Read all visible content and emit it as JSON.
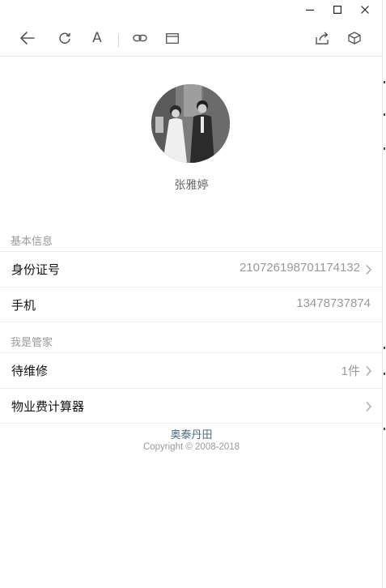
{
  "window": {
    "controls": [
      {
        "name": "minimize",
        "icon": "minimize-icon"
      },
      {
        "name": "maximize",
        "icon": "maximize-icon"
      },
      {
        "name": "close",
        "icon": "close-icon"
      }
    ]
  },
  "toolbar": {
    "icons": [
      "back-arrow-icon",
      "refresh-icon",
      "font-size-icon",
      "link-icon",
      "window-icon",
      "share-icon",
      "box-icon"
    ],
    "font_label": "A"
  },
  "profile": {
    "name": "张雅婷",
    "avatar": "wedding-photo-avatar"
  },
  "sections": {
    "basic": {
      "title": "基本信息",
      "rows": [
        {
          "label": "身份证号",
          "value": "210726198701174132"
        },
        {
          "label": "手机",
          "value": "13478737874"
        }
      ]
    },
    "steward": {
      "title": "我是管家",
      "rows": [
        {
          "label": "待维修",
          "value": "1件"
        },
        {
          "label": "物业费计算器",
          "value": ""
        }
      ]
    }
  },
  "footer": {
    "brand": "奥泰丹田",
    "copyright": "Copyright © 2008-2018"
  },
  "colors": {
    "link": "#4b6b86",
    "muted": "#999999",
    "divider": "#ececec"
  }
}
